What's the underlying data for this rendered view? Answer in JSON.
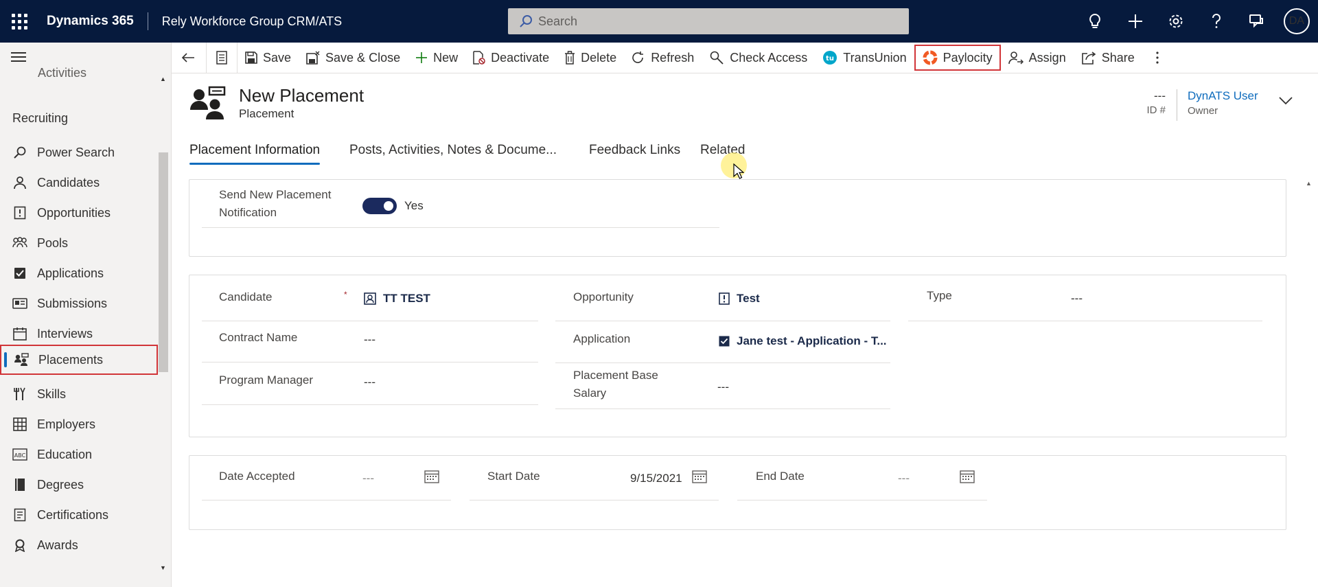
{
  "topbar": {
    "app_name": "Dynamics 365",
    "environment": "Rely Workforce Group CRM/ATS",
    "search_placeholder": "Search",
    "avatar_initials": "DA",
    "icons": [
      "lightbulb-icon",
      "plus-icon",
      "gear-icon",
      "help-icon",
      "chat-icon"
    ]
  },
  "sidebar": {
    "partial_item": "Activities",
    "group_label": "Recruiting",
    "items": [
      {
        "label": "Power Search",
        "icon": "search-icon"
      },
      {
        "label": "Candidates",
        "icon": "person-icon"
      },
      {
        "label": "Opportunities",
        "icon": "opportunity-icon"
      },
      {
        "label": "Pools",
        "icon": "people-group-icon"
      },
      {
        "label": "Applications",
        "icon": "checkbox-icon"
      },
      {
        "label": "Submissions",
        "icon": "submission-icon"
      },
      {
        "label": "Interviews",
        "icon": "calendar-icon"
      },
      {
        "label": "Placements",
        "icon": "placement-icon",
        "active": true
      },
      {
        "label": "Skills",
        "icon": "tools-icon"
      },
      {
        "label": "Employers",
        "icon": "building-icon"
      },
      {
        "label": "Education",
        "icon": "abc-icon"
      },
      {
        "label": "Degrees",
        "icon": "book-icon"
      },
      {
        "label": "Certifications",
        "icon": "certificate-icon"
      },
      {
        "label": "Awards",
        "icon": "award-icon"
      }
    ]
  },
  "commandbar": {
    "save": "Save",
    "save_close": "Save & Close",
    "new": "New",
    "deactivate": "Deactivate",
    "delete": "Delete",
    "refresh": "Refresh",
    "check_access": "Check Access",
    "transunion": "TransUnion",
    "paylocity": "Paylocity",
    "assign": "Assign",
    "share": "Share"
  },
  "header": {
    "title": "New Placement",
    "entity": "Placement",
    "id_value": "---",
    "id_label": "ID #",
    "owner_value": "DynATS User",
    "owner_label": "Owner"
  },
  "tabs": [
    {
      "label": "Placement Information",
      "active": true
    },
    {
      "label": "Posts, Activities, Notes & Docume..."
    },
    {
      "label": "Feedback Links"
    },
    {
      "label": "Related"
    }
  ],
  "section1": {
    "notify_label_1": "Send New Placement",
    "notify_label_2": "Notification",
    "notify_value": "Yes"
  },
  "section2": {
    "candidate_label": "Candidate",
    "candidate_required": "*",
    "candidate_value": "TT TEST",
    "contract_label": "Contract Name",
    "contract_value": "---",
    "pm_label": "Program Manager",
    "pm_value": "---",
    "opportunity_label": "Opportunity",
    "opportunity_value": "Test",
    "application_label": "Application",
    "application_value": "Jane test - Application - T...",
    "salary_label_1": "Placement Base",
    "salary_label_2": "Salary",
    "salary_value": "---",
    "type_label": "Type",
    "type_value": "---"
  },
  "section3": {
    "accepted_label": "Date Accepted",
    "accepted_value": "---",
    "start_label": "Start Date",
    "start_value": "9/15/2021",
    "end_label": "End Date",
    "end_value": "---"
  }
}
